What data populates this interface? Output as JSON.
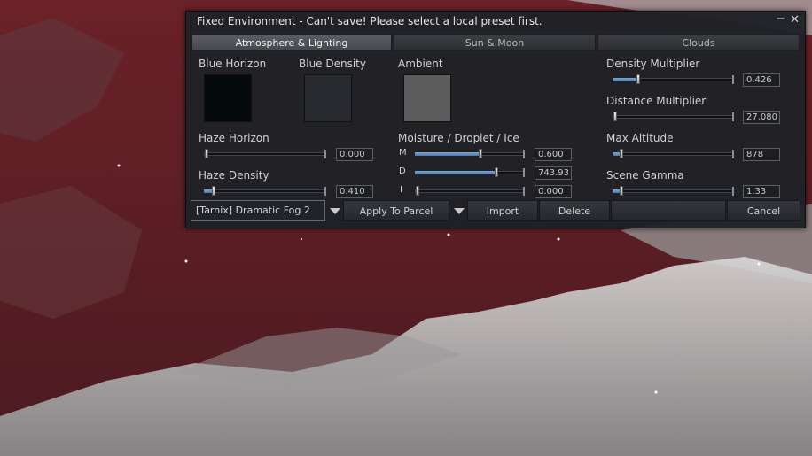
{
  "colors": {
    "sky": "#5a1f25",
    "panel": "#1e2126",
    "slider_fill": "#4a78a8",
    "blue_horizon": "#04090c",
    "blue_density": "#272a2e",
    "ambient": "#5d5d5d"
  },
  "window": {
    "title": "Fixed Environment - Can't save! Please select a local preset first.",
    "minimize_icon": "minimize-icon",
    "close_icon": "close-icon"
  },
  "tabs": [
    {
      "label": "Atmosphere & Lighting",
      "active": true
    },
    {
      "label": "Sun & Moon",
      "active": false
    },
    {
      "label": "Clouds",
      "active": false
    }
  ],
  "atmosphere": {
    "blue_horizon": {
      "label": "Blue Horizon"
    },
    "blue_density": {
      "label": "Blue Density"
    },
    "ambient": {
      "label": "Ambient"
    },
    "haze_horizon": {
      "label": "Haze Horizon",
      "value": "0.000",
      "fraction": 0.0
    },
    "haze_density": {
      "label": "Haze Density",
      "value": "0.410",
      "fraction": 0.08
    },
    "moisture": {
      "label": "Moisture / Droplet / Ice",
      "m": {
        "letter": "M",
        "value": "0.600",
        "fraction": 0.6
      },
      "d": {
        "letter": "D",
        "value": "743.93",
        "fraction": 0.74
      },
      "i": {
        "letter": "I",
        "value": "0.000",
        "fraction": 0.0
      }
    },
    "density_multiplier": {
      "label": "Density Multiplier",
      "value": "0.426",
      "fraction": 0.21
    },
    "distance_multiplier": {
      "label": "Distance Multiplier",
      "value": "27.080",
      "fraction": 0.0
    },
    "max_altitude": {
      "label": "Max Altitude",
      "value": "878",
      "fraction": 0.07
    },
    "scene_gamma": {
      "label": "Scene Gamma",
      "value": "1.33",
      "fraction": 0.07
    }
  },
  "bottom": {
    "preset": "[Tarnix] Dramatic Fog 2",
    "apply_to_parcel": "Apply To Parcel",
    "import": "Import",
    "delete": "Delete",
    "cancel": "Cancel"
  }
}
